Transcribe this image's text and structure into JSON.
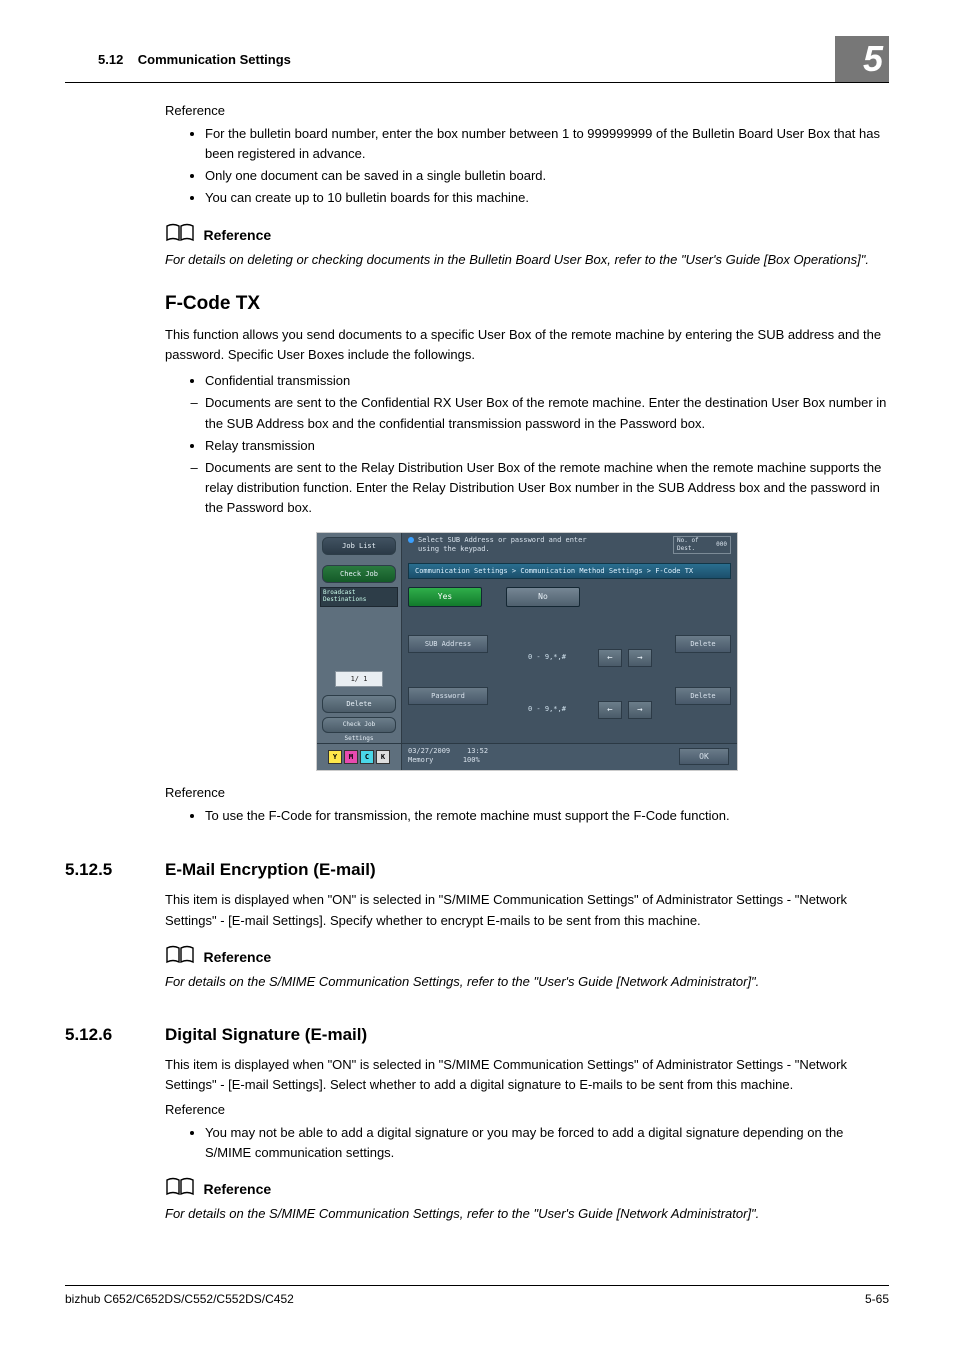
{
  "header": {
    "section_no": "5.12",
    "section_title": "Communication Settings",
    "chapter_badge": "5"
  },
  "ref1": {
    "label": "Reference",
    "bullets": [
      "For the bulletin board number, enter the box number between 1 to 999999999 of the Bulletin Board User Box that has been registered in advance.",
      "Only one document can be saved in a single bulletin board.",
      "You can create up to 10 bulletin boards for this machine."
    ]
  },
  "icon_reference_label": "Reference",
  "ref_note1": "For details on deleting or checking documents in the Bulletin Board User Box, refer to the \"User's Guide [Box Operations]\".",
  "fcode": {
    "heading": "F-Code TX",
    "intro": "This function allows you send documents to a specific User Box of the remote machine by entering the SUB address and the password. Specific User Boxes include the followings.",
    "b1": "Confidential transmission",
    "s1": "Documents are sent to the Confidential RX User Box of the remote machine. Enter the destination User Box number in the SUB Address box and the confidential transmission password in the Password box.",
    "b2": "Relay transmission",
    "s2": "Documents are sent to the Relay Distribution User Box of the remote machine when the remote machine supports the relay distribution function. Enter the Relay Distribution User Box number in the SUB Address box and the password in the Password box."
  },
  "device": {
    "job_list": "Job List",
    "check_job": "Check Job",
    "hint": "Select SUB Address or password and enter\nusing the keypad.",
    "dest_label": "No. of\nDest.",
    "dest_value": "000",
    "path": "Communication Settings > Communication Method Settings > F-Code TX",
    "yes": "Yes",
    "no": "No",
    "broadcast": "Broadcast\nDestinations",
    "sub_address": "SUB Address",
    "allowed": "0 - 9,*,#",
    "delete_btn": "Delete",
    "password": "Password",
    "page": "1/  1",
    "delete_side": "Delete",
    "check_settings": "Check Job\nSettings",
    "toner_y": "Y",
    "toner_m": "M",
    "toner_c": "C",
    "toner_k": "K",
    "date": "03/27/2009",
    "time": "13:52",
    "mem_label": "Memory",
    "mem_value": "100%",
    "ok": "OK"
  },
  "ref2": {
    "label": "Reference",
    "bullet": "To use the F-Code for transmission, the remote machine must support the F-Code function."
  },
  "sec5": {
    "num": "5.12.5",
    "title": "E-Mail Encryption (E-mail)",
    "body": "This item is displayed when \"ON\" is selected in \"S/MIME Communication Settings\" of Administrator Settings - \"Network Settings\" - [E-mail Settings]. Specify whether to encrypt E-mails to be sent from this machine.",
    "ref_note": "For details on the S/MIME Communication Settings, refer to the \"User's Guide [Network Administrator]\"."
  },
  "sec6": {
    "num": "5.12.6",
    "title": "Digital Signature (E-mail)",
    "body": "This item is displayed when \"ON\" is selected in \"S/MIME Communication Settings\" of Administrator Settings - \"Network Settings\" - [E-mail Settings]. Select whether to add a digital signature to E-mails to be sent from this machine.",
    "ref_label": "Reference",
    "ref_bullet": "You may not be able to add a digital signature or you may be forced to add a digital signature depending on the S/MIME communication settings.",
    "ref_note": "For details on the S/MIME Communication Settings, refer to the \"User's Guide [Network Administrator]\"."
  },
  "footer": {
    "left": "bizhub C652/C652DS/C552/C552DS/C452",
    "right": "5-65"
  }
}
